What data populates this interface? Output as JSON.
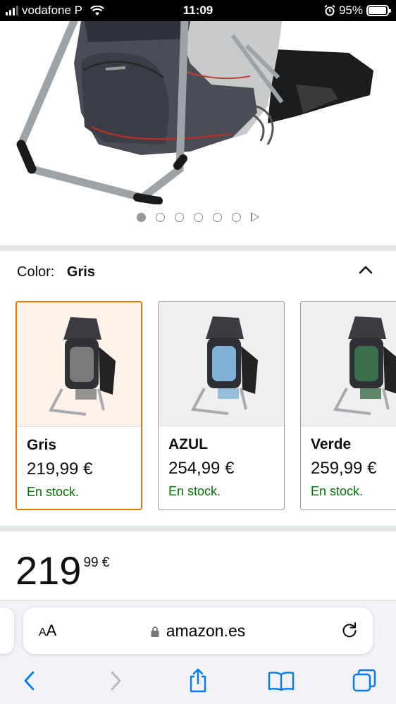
{
  "status_bar": {
    "carrier": "vodafone P",
    "time": "11:09",
    "battery": "95%",
    "battery_level": 0.95
  },
  "gallery": {
    "image_alt": "Mochila portabebés gris",
    "dot_count": 6,
    "active_dot": 0,
    "video_icon": "play-icon"
  },
  "color_selector": {
    "label": "Color:",
    "selected": "Gris",
    "collapse_icon": "chevron-up-icon"
  },
  "variants": [
    {
      "name": "Gris",
      "price": "219,99 €",
      "stock": "En stock.",
      "accent": "#7a7a7a",
      "selected": true
    },
    {
      "name": "AZUL",
      "price": "254,99 €",
      "stock": "En stock.",
      "accent": "#7fb3d5",
      "selected": false
    },
    {
      "name": "Verde",
      "price": "259,99 €",
      "stock": "En stock.",
      "accent": "#3b6e4a",
      "selected": false
    }
  ],
  "price": {
    "whole": "219",
    "fraction": "99 €"
  },
  "safari": {
    "text_size_label": "AA",
    "url": "amazon.es",
    "toolbar_icons": [
      "back-icon",
      "forward-icon",
      "share-icon",
      "bookmarks-icon",
      "tabs-icon"
    ]
  },
  "colors": {
    "selected_border": "#e77600",
    "in_stock": "#007600",
    "ios_blue": "#007aff"
  }
}
